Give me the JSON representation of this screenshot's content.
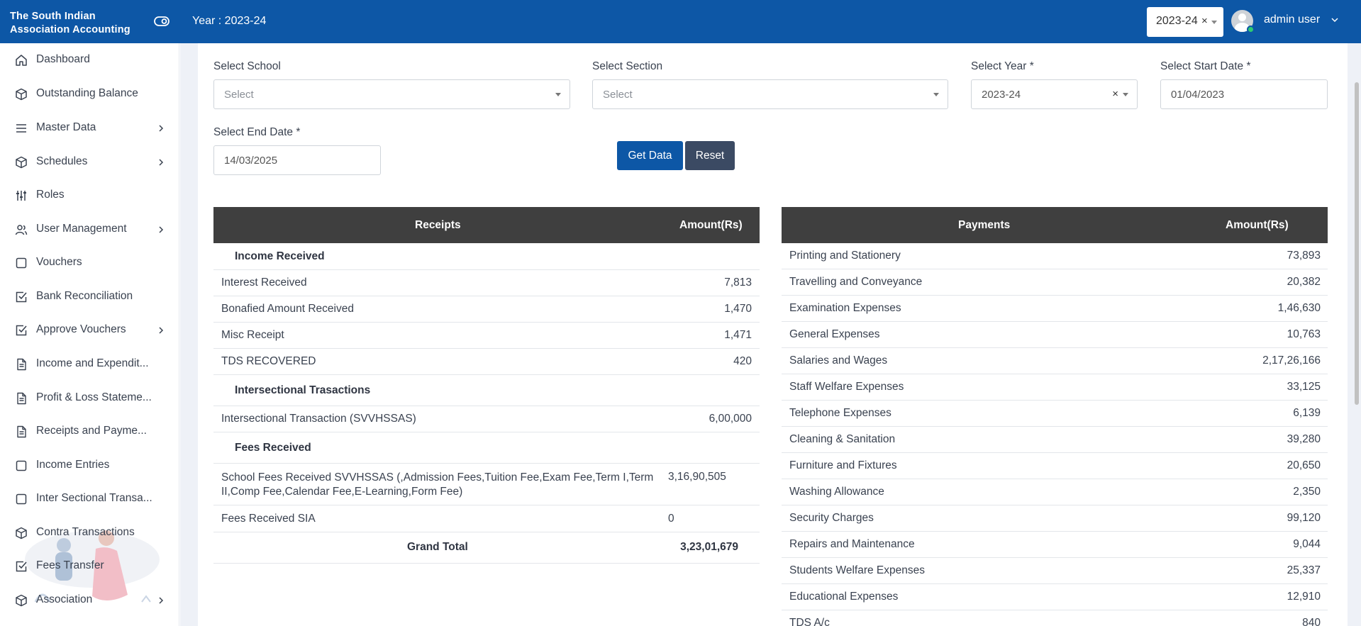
{
  "header": {
    "brand": "The South Indian Association Accounting",
    "year_label": "Year : 2023-24",
    "year_select": "2023-24",
    "year_clear": "×",
    "user_name": "admin user"
  },
  "sidebar": {
    "items": [
      {
        "label": "Dashboard",
        "icon": "home-icon"
      },
      {
        "label": "Outstanding Balance",
        "icon": "cube-icon"
      },
      {
        "label": "Master Data",
        "icon": "list-icon"
      },
      {
        "label": "Schedules",
        "icon": "cube-icon"
      },
      {
        "label": "Roles",
        "icon": "sliders-icon"
      },
      {
        "label": "User Management",
        "icon": "users-icon"
      },
      {
        "label": "Vouchers",
        "icon": "square-icon"
      },
      {
        "label": "Bank Reconciliation",
        "icon": "check-square-icon"
      },
      {
        "label": "Approve Vouchers",
        "icon": "check-square-icon"
      },
      {
        "label": "Income and Expendit...",
        "icon": "document-icon"
      },
      {
        "label": "Profit & Loss Stateme...",
        "icon": "document-icon"
      },
      {
        "label": "Receipts and Payme...",
        "icon": "document-icon"
      },
      {
        "label": "Income Entries",
        "icon": "square-icon"
      },
      {
        "label": "Inter Sectional Transa...",
        "icon": "square-icon"
      },
      {
        "label": "Contra Transactions",
        "icon": "cube-icon"
      },
      {
        "label": "Fees Transfer",
        "icon": "check-square-icon"
      },
      {
        "label": "Association",
        "icon": "cube-icon"
      }
    ]
  },
  "filters": {
    "school_label": "Select School",
    "school_value": "Select",
    "section_label": "Select Section",
    "section_value": "Select",
    "year_label": "Select Year *",
    "year_value": "2023-24",
    "year_clear": "×",
    "start_label": "Select Start Date *",
    "start_value": "01/04/2023",
    "end_label": "Select End Date *",
    "end_value": "14/03/2025",
    "get_data": "Get Data",
    "reset": "Reset"
  },
  "receipts": {
    "header_name": "Receipts",
    "header_amount": "Amount(Rs)",
    "section_income": "Income Received",
    "income_rows": [
      {
        "name": "Interest Received",
        "amount": "7,813"
      },
      {
        "name": "Bonafied Amount Received",
        "amount": "1,470"
      },
      {
        "name": "Misc Receipt",
        "amount": "1,471"
      },
      {
        "name": "TDS RECOVERED",
        "amount": "420"
      }
    ],
    "section_inter": "Intersectional Trasactions",
    "inter_row": {
      "name": "Intersectional Transaction (SVVHSSAS)",
      "amount": "6,00,000"
    },
    "section_fees": "Fees Received",
    "fees_row1": {
      "name_line1": "School Fees Received SVVHSSAS (,Admission Fees,Tuition Fee,Exam Fee,Term I,Term",
      "name_line2": "II,Comp Fee,Calendar Fee,E-Learning,Form Fee)",
      "amount": "3,16,90,505"
    },
    "fees_row2": {
      "name": "Fees Received SIA",
      "amount": "0"
    },
    "total_label": "Grand Total",
    "total_amount": "3,23,01,679"
  },
  "payments": {
    "header_name": "Payments",
    "header_amount": "Amount(Rs)",
    "rows": [
      {
        "name": "Printing and Stationery",
        "amount": "73,893"
      },
      {
        "name": "Travelling and Conveyance",
        "amount": "20,382"
      },
      {
        "name": "Examination Expenses",
        "amount": "1,46,630"
      },
      {
        "name": "General Expenses",
        "amount": "10,763"
      },
      {
        "name": "Salaries and Wages",
        "amount": "2,17,26,166"
      },
      {
        "name": "Staff Welfare Expenses",
        "amount": "33,125"
      },
      {
        "name": "Telephone Expenses",
        "amount": "6,139"
      },
      {
        "name": "Cleaning & Sanitation",
        "amount": "39,280"
      },
      {
        "name": "Furniture and Fixtures",
        "amount": "20,650"
      },
      {
        "name": "Washing Allowance",
        "amount": "2,350"
      },
      {
        "name": "Security Charges",
        "amount": "99,120"
      },
      {
        "name": "Repairs and Maintenance",
        "amount": "9,044"
      },
      {
        "name": "Students Welfare Expenses",
        "amount": "25,337"
      },
      {
        "name": "Educational Expenses",
        "amount": "12,910"
      },
      {
        "name": "TDS A/c",
        "amount": "840"
      }
    ]
  }
}
